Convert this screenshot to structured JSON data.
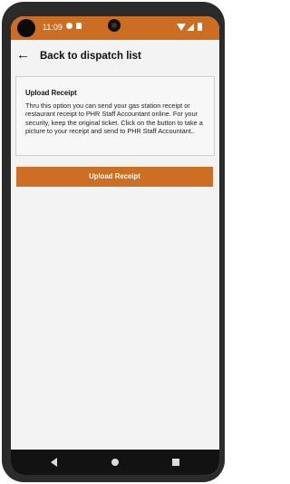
{
  "status_bar": {
    "time": "11:09"
  },
  "app_bar": {
    "title": "Back to dispatch list"
  },
  "card": {
    "title": "Upload Receipt",
    "body": "Thru this option you can send your gas station receipt or restaurant receipt to PHR Staff Accountant online. For your security, keep the original ticket. Click on the button to take a picture to your receipt and send to PHR Staff Accountant.."
  },
  "upload_button": {
    "label": "Upload Receipt"
  },
  "colors": {
    "accent": "#cd6f22",
    "background": "#f3f3f3",
    "nav_bar": "#121212"
  }
}
